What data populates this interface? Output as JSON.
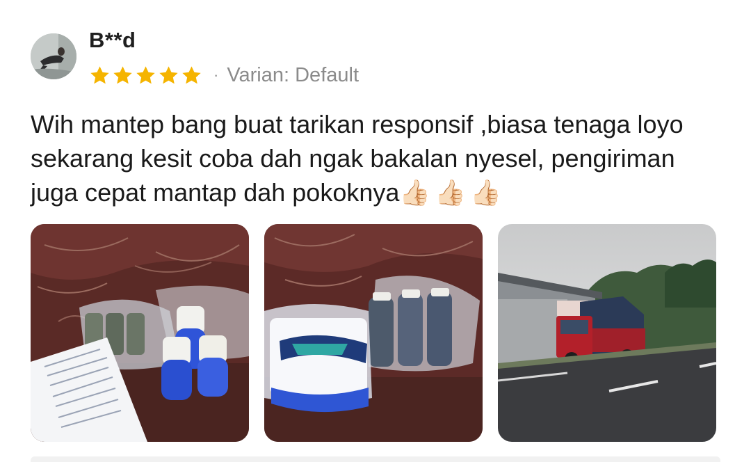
{
  "review": {
    "username": "B**d",
    "rating": 5,
    "rating_max": 5,
    "separator": "·",
    "variant": "Varian: Default",
    "text": "Wih mantep bang buat tarikan responsif ,biasa tenaga loyo sekarang kesit coba dah ngak bakalan nyesel, pengiriman juga cepat mantap dah pokoknya",
    "emoji": "👍🏻👍🏻👍🏻",
    "photos": [
      {
        "icon": "product-photo-bottles-with-paper"
      },
      {
        "icon": "product-photo-package"
      },
      {
        "icon": "photo-red-truck-on-road"
      }
    ]
  },
  "colors": {
    "star": "#f5b400",
    "text": "#1a1a1a",
    "muted": "#8b8b8b"
  }
}
